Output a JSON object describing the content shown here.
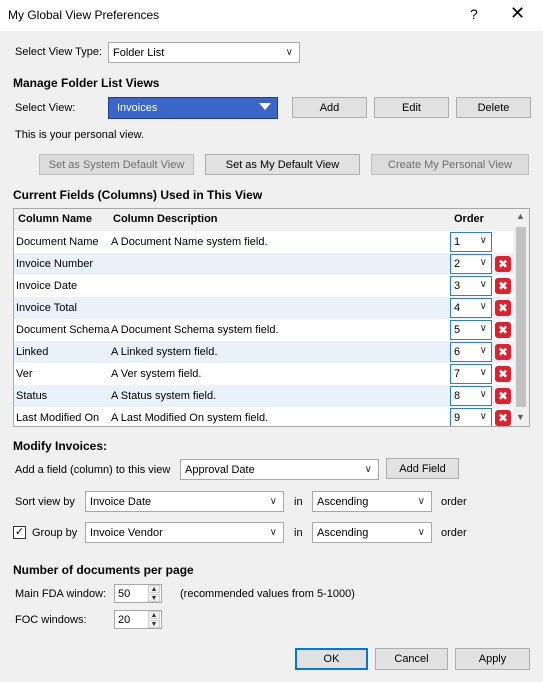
{
  "window": {
    "title": "My Global View Preferences",
    "help": "?",
    "close": "✕"
  },
  "view_type": {
    "label": "Select View Type:",
    "value": "Folder List"
  },
  "manage": {
    "heading": "Manage Folder List Views",
    "select_label": "Select View:",
    "select_value": "Invoices",
    "add": "Add",
    "edit": "Edit",
    "delete": "Delete",
    "personal_note": "This is your personal view.",
    "set_system_default": "Set as System Default View",
    "set_my_default": "Set as My Default View",
    "create_personal": "Create My Personal View"
  },
  "fields": {
    "heading": "Current Fields (Columns) Used in This View",
    "col_name": "Column Name",
    "col_desc": "Column Description",
    "col_order": "Order",
    "rows": [
      {
        "name": "Document Name",
        "desc": "A Document Name system field.",
        "order": "1",
        "deletable": false
      },
      {
        "name": "Invoice Number",
        "desc": "",
        "order": "2",
        "deletable": true
      },
      {
        "name": "Invoice Date",
        "desc": "",
        "order": "3",
        "deletable": true
      },
      {
        "name": "Invoice Total",
        "desc": "",
        "order": "4",
        "deletable": true
      },
      {
        "name": "Document Schema",
        "desc": "A Document Schema system field.",
        "order": "5",
        "deletable": true
      },
      {
        "name": "Linked",
        "desc": "A Linked system field.",
        "order": "6",
        "deletable": true
      },
      {
        "name": "Ver",
        "desc": "A Ver system field.",
        "order": "7",
        "deletable": true
      },
      {
        "name": "Status",
        "desc": "A Status system field.",
        "order": "8",
        "deletable": true
      },
      {
        "name": "Last Modified On",
        "desc": "A Last Modified On system field.",
        "order": "9",
        "deletable": true
      }
    ]
  },
  "modify": {
    "heading": "Modify Invoices:",
    "add_field_label": "Add a field (column) to this view",
    "add_field_value": "Approval Date",
    "add_field_button": "Add Field",
    "sort_label": "Sort view by",
    "sort_field": "Invoice Date",
    "sort_in": "in",
    "sort_dir": "Ascending",
    "sort_order": "order",
    "group_checked": true,
    "group_label": "Group by",
    "group_field": "Invoice Vendor",
    "group_in": "in",
    "group_dir": "Ascending",
    "group_order": "order"
  },
  "docs": {
    "heading": "Number of documents per page",
    "main_label": "Main FDA window:",
    "main_value": "50",
    "main_hint": "(recommended values from 5-1000)",
    "foc_label": "FOC windows:",
    "foc_value": "20"
  },
  "footer": {
    "ok": "OK",
    "cancel": "Cancel",
    "apply": "Apply"
  }
}
